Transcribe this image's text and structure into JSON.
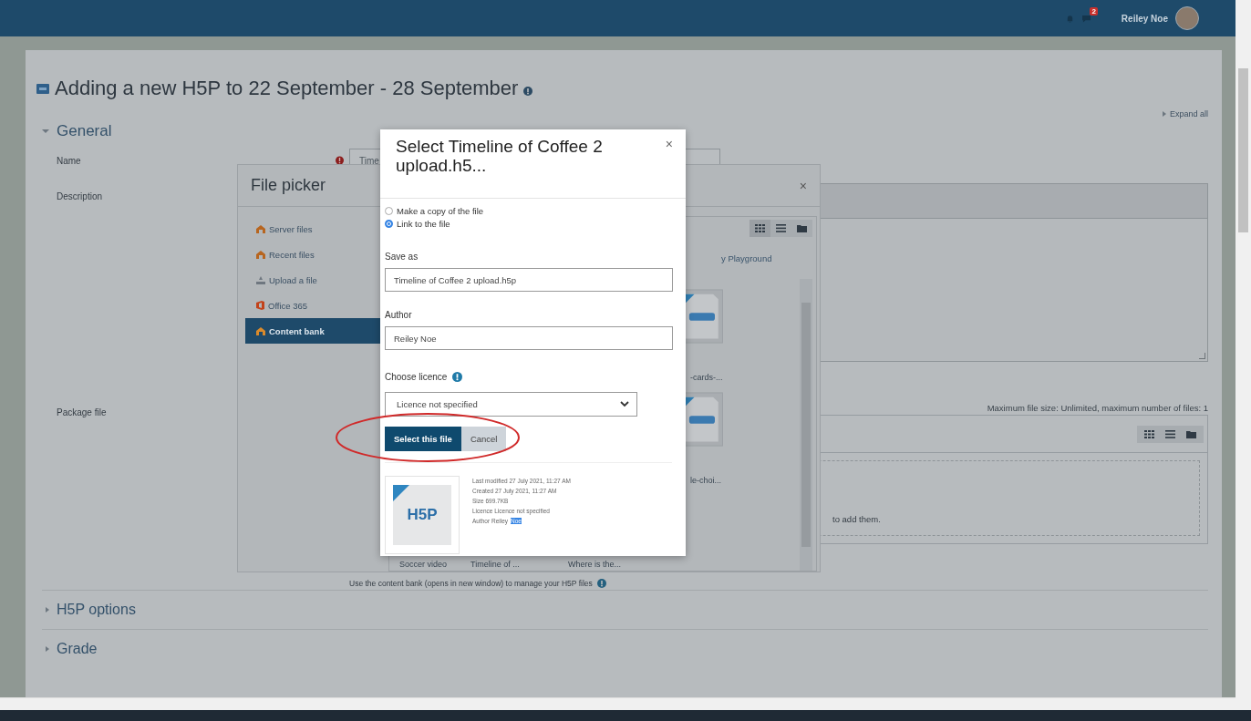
{
  "navbar": {
    "notification_count": "2",
    "user_name": "Reiley Noe"
  },
  "page": {
    "title": "Adding a new H5P to 22 September - 28 September",
    "expand_all": "Expand all"
  },
  "sections": [
    {
      "title": "General",
      "expanded": true
    },
    {
      "title": "H5P options",
      "expanded": false
    },
    {
      "title": "Grade",
      "expanded": false
    }
  ],
  "form": {
    "name_label": "Name",
    "name_value": "Time",
    "description_label": "Description",
    "package_label": "Package file",
    "max_size_note": "Maximum file size: Unlimited, maximum number of files: 1",
    "drop_hint": "to add them.",
    "content_bank_note": "Use the content bank (opens in new window) to manage your H5P files"
  },
  "file_picker": {
    "title": "File picker",
    "close": "×",
    "repositories": [
      {
        "label": "Server files",
        "kind": "server",
        "selected": false
      },
      {
        "label": "Recent files",
        "kind": "recent",
        "selected": false
      },
      {
        "label": "Upload a file",
        "kind": "upload",
        "selected": false
      },
      {
        "label": "Office 365",
        "kind": "office",
        "selected": false
      },
      {
        "label": "Content bank",
        "kind": "contentbank",
        "selected": true
      }
    ],
    "views": [
      {
        "kind": "grid",
        "selected": true
      },
      {
        "kind": "list",
        "selected": false
      },
      {
        "kind": "tree",
        "selected": false
      }
    ],
    "path": "y Playground",
    "files": [
      {
        "name": "-cards-..."
      },
      {
        "name": "le-choi..."
      }
    ],
    "last_row": [
      {
        "name": "Soccer video"
      },
      {
        "name": "Timeline of ..."
      },
      {
        "name": "Where is the..."
      }
    ]
  },
  "select_dialog": {
    "title": "Select Timeline of Coffee 2 upload.h5...",
    "close": "×",
    "link_options": [
      {
        "label": "Make a copy of the file",
        "selected": false
      },
      {
        "label": "Link to the file",
        "selected": true
      }
    ],
    "save_as_label": "Save as",
    "save_as_value": "Timeline of Coffee 2 upload.h5p",
    "author_label": "Author",
    "author_value": "Reiley Noe",
    "licence_label": "Choose licence",
    "licence_value": "Licence not specified",
    "buttons": [
      {
        "label": "Select this file",
        "kind": "primary"
      },
      {
        "label": "Cancel",
        "kind": "secondary"
      }
    ],
    "thumbnail_text": "H5P",
    "details": [
      {
        "text": "Last modified 27 July 2021, 11:27 AM"
      },
      {
        "text": "Created 27 July 2021, 11:27 AM"
      },
      {
        "text": "Size 699.7KB"
      },
      {
        "text": "Licence Licence not specified"
      },
      {
        "text": "Author Reiley",
        "highlight": "Noe"
      }
    ]
  },
  "annotation": {
    "kind": "ellipse"
  }
}
